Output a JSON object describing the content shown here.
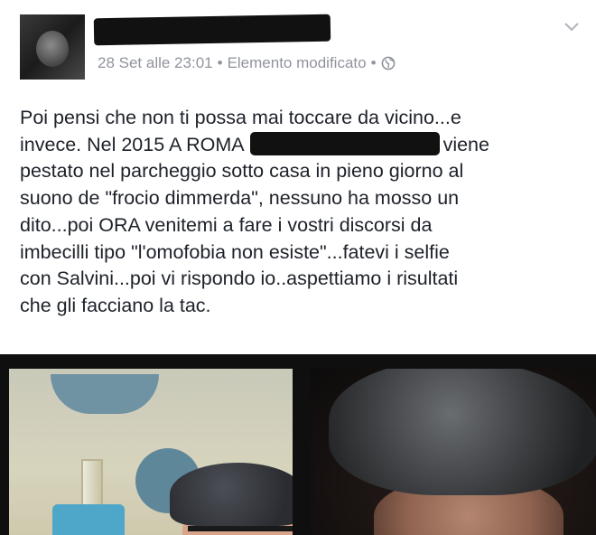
{
  "post": {
    "timestamp": "28 Set alle 23:01",
    "separator": "•",
    "edited_label": "Elemento modificato",
    "privacy_icon": "globe-icon",
    "menu_icon": "chevron-down-icon",
    "text_lines": [
      "Poi pensi che non ti possa mai toccare da vicino...e",
      "invece. Nel 2015 A ROMA",
      "viene",
      "pestato nel parcheggio sotto casa in pieno giorno al",
      "suono de \"frocio dimmerda\", nessuno ha mosso un",
      "dito...poi ORA venitemi a fare i vostri discorsi da",
      "imbecilli tipo \"l'omofobia non esiste\"...fatevi i selfie",
      "con Salvini...poi vi rispondo io..aspettiamo i risultati",
      "che gli facciano la tac."
    ]
  },
  "colors": {
    "text": "#1d2129",
    "meta": "#90949c",
    "redaction": "#111111"
  }
}
